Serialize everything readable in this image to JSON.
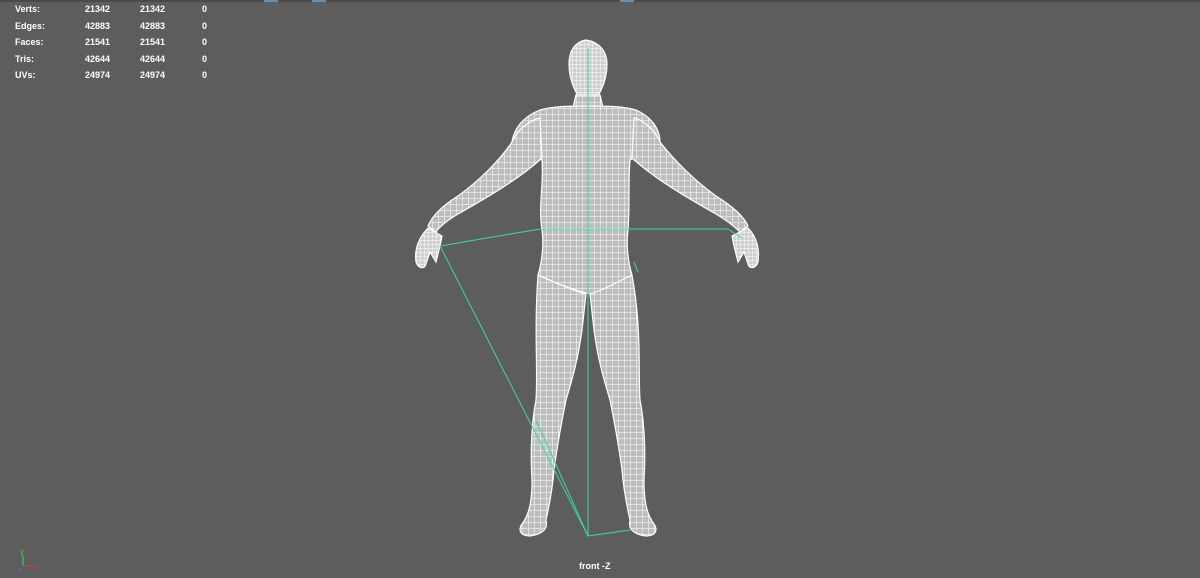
{
  "hud": {
    "rows": [
      {
        "label": "Verts:",
        "v1": "21342",
        "v2": "21342",
        "v3": "0"
      },
      {
        "label": "Edges:",
        "v1": "42883",
        "v2": "42883",
        "v3": "0"
      },
      {
        "label": "Faces:",
        "v1": "21541",
        "v2": "21541",
        "v3": "0"
      },
      {
        "label": "Tris:",
        "v1": "42644",
        "v2": "42644",
        "v3": "0"
      },
      {
        "label": "UVs:",
        "v1": "24974",
        "v2": "24974",
        "v3": "0"
      }
    ]
  },
  "viewport": {
    "camera_label": "front -Z",
    "background": "#5d5d5d",
    "wire_color": "#ffffff",
    "joint_color": "#3fd6a0"
  },
  "axis_gizmo": {
    "y_label": "y",
    "x_label": "x",
    "z_label": "z"
  }
}
